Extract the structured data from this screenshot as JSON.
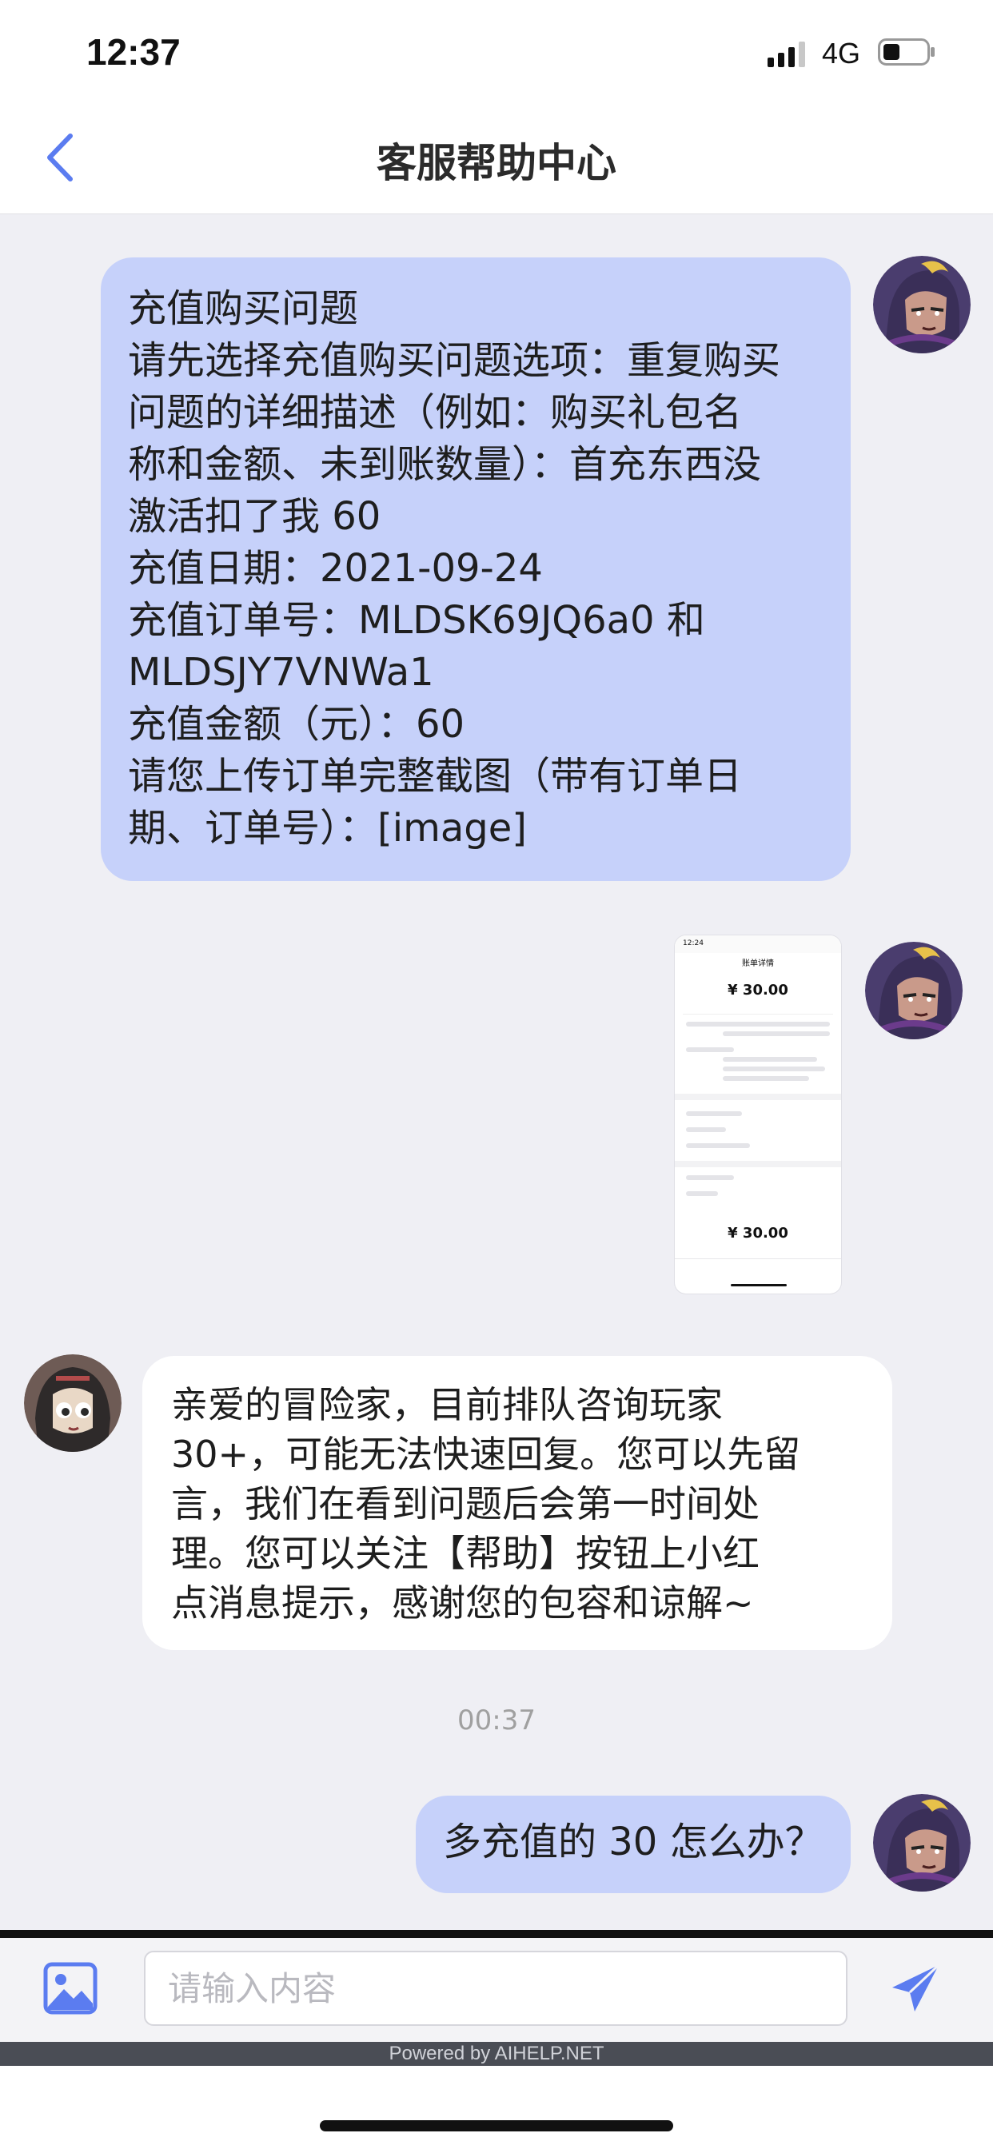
{
  "status_bar": {
    "time": "12:37",
    "network": "4G"
  },
  "header": {
    "title": "客服帮助中心",
    "back_icon": "chevron-left-icon"
  },
  "messages": [
    {
      "side": "right",
      "lines": [
        "充值购买问题",
        "请先选择充值购买问题选项：重复购买",
        "问题的详细描述（例如：购买礼包名",
        "称和金额、未到账数量）：首充东西没",
        "激活扣了我 60",
        "充值日期：2021-09-24",
        "充值订单号：MLDSK69JQ6a0 和",
        "MLDSJY7VNWa1",
        "充值金额（元）：60",
        "请您上传订单完整截图（带有订单日",
        "期、订单号）：[image]"
      ]
    },
    {
      "side": "right",
      "type": "image",
      "screenshot": {
        "time": "12:24",
        "title": "账单详情",
        "amount": "¥ 30.00",
        "amount2": "¥ 30.00"
      }
    },
    {
      "side": "left",
      "lines": [
        "亲爱的冒险家，目前排队咨询玩家",
        "30+，可能无法快速回复。您可以先留",
        "言，我们在看到问题后会第一时间处",
        "理。您可以关注【帮助】按钮上小红",
        "点消息提示，感谢您的包容和谅解~"
      ]
    },
    {
      "type": "timestamp",
      "text": "00:37"
    },
    {
      "side": "right",
      "lines": [
        "多充值的 30 怎么办？"
      ]
    }
  ],
  "input": {
    "placeholder": "请输入内容"
  },
  "footer": {
    "powered_by": "Powered by AIHELP.NET"
  },
  "colors": {
    "accent": "#5b7cf0",
    "outgoing_bubble": "#c6d1fa",
    "incoming_bubble": "#ffffff",
    "background": "#efeff4"
  }
}
